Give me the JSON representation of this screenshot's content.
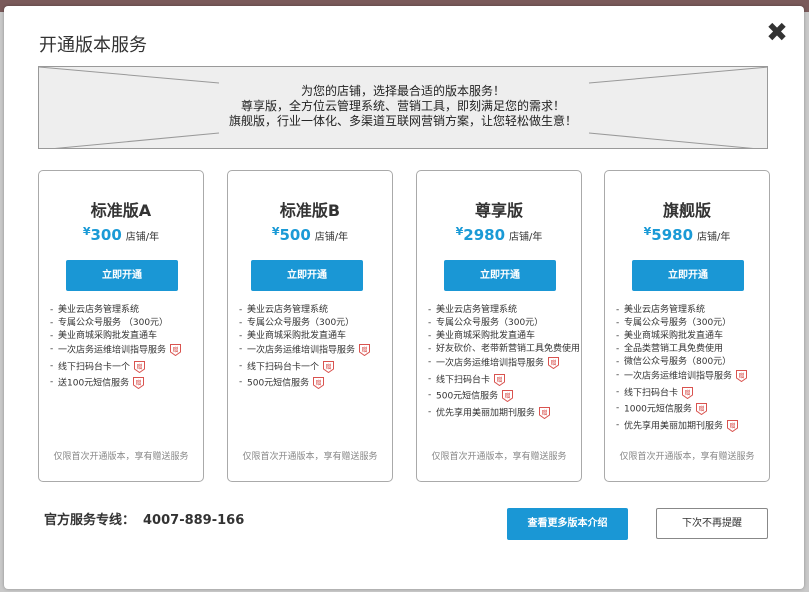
{
  "modal": {
    "title": "开通版本服务",
    "close_icon": "✖"
  },
  "banner": {
    "lines": [
      "为您的店铺，选择最合适的版本服务！",
      "尊享版，全方位云管理系统、营销工具，即刻满足您的需求！",
      "旗舰版，行业一体化、多渠道互联网营销方案，让您轻松做生意！"
    ]
  },
  "plans": [
    {
      "name": "标准版A",
      "currency": "¥",
      "price": "300",
      "unit": "店铺/年",
      "button": "立即开通",
      "features": [
        {
          "text": "美业云店务管理系统",
          "gift": false
        },
        {
          "text": "专属公众号服务 （300元）",
          "gift": false
        },
        {
          "text": "美业商城采购批发直通车",
          "gift": false
        },
        {
          "text": "一次店务运维培训指导服务",
          "gift": true
        },
        {
          "text": "线下扫码台卡一个",
          "gift": true
        },
        {
          "text": "送100元短信服务",
          "gift": true
        }
      ],
      "note": "仅限首次开通版本，享有赠送服务"
    },
    {
      "name": "标准版B",
      "currency": "¥",
      "price": "500",
      "unit": "店铺/年",
      "button": "立即开通",
      "features": [
        {
          "text": "美业云店务管理系统",
          "gift": false
        },
        {
          "text": "专属公众号服务（300元）",
          "gift": false
        },
        {
          "text": "美业商城采购批发直通车",
          "gift": false
        },
        {
          "text": "一次店务运维培训指导服务",
          "gift": true
        },
        {
          "text": "线下扫码台卡一个",
          "gift": true
        },
        {
          "text": "500元短信服务",
          "gift": true
        }
      ],
      "note": "仅限首次开通版本，享有赠送服务"
    },
    {
      "name": "尊享版",
      "currency": "¥",
      "price": "2980",
      "unit": "店铺/年",
      "button": "立即开通",
      "features": [
        {
          "text": "美业云店务管理系统",
          "gift": false
        },
        {
          "text": "专属公众号服务（300元）",
          "gift": false
        },
        {
          "text": "美业商城采购批发直通车",
          "gift": false
        },
        {
          "text": "好友砍价、老带新营销工具免费使用",
          "gift": false
        },
        {
          "text": "一次店务运维培训指导服务",
          "gift": true
        },
        {
          "text": "线下扫码台卡",
          "gift": true
        },
        {
          "text": "500元短信服务",
          "gift": true
        },
        {
          "text": "优先享用美丽加期刊服务",
          "gift": true
        }
      ],
      "note": "仅限首次开通版本，享有赠送服务"
    },
    {
      "name": "旗舰版",
      "currency": "¥",
      "price": "5980",
      "unit": "店铺/年",
      "button": "立即开通",
      "features": [
        {
          "text": "美业云店务管理系统",
          "gift": false
        },
        {
          "text": "专属公众号服务（300元）",
          "gift": false
        },
        {
          "text": "美业商城采购批发直通车",
          "gift": false
        },
        {
          "text": "全品类营销工具免费使用",
          "gift": false
        },
        {
          "text": "微信公众号服务（800元）",
          "gift": false
        },
        {
          "text": "一次店务运维培训指导服务",
          "gift": true
        },
        {
          "text": "线下扫码台卡",
          "gift": true
        },
        {
          "text": "1000元短信服务",
          "gift": true
        },
        {
          "text": "优先享用美丽加期刊服务",
          "gift": true
        }
      ],
      "note": "仅限首次开通版本，享有赠送服务"
    }
  ],
  "gift_icon": {
    "name": "gift-badge-icon",
    "char": "赠",
    "color": "#d9534f"
  },
  "colors": {
    "accent": "#1a97d5"
  },
  "footer": {
    "hotline_label": "官方服务专线：",
    "hotline_number": "4007-889-166",
    "more_button": "查看更多版本介绍",
    "no_remind_button": "下次不再提醒"
  }
}
